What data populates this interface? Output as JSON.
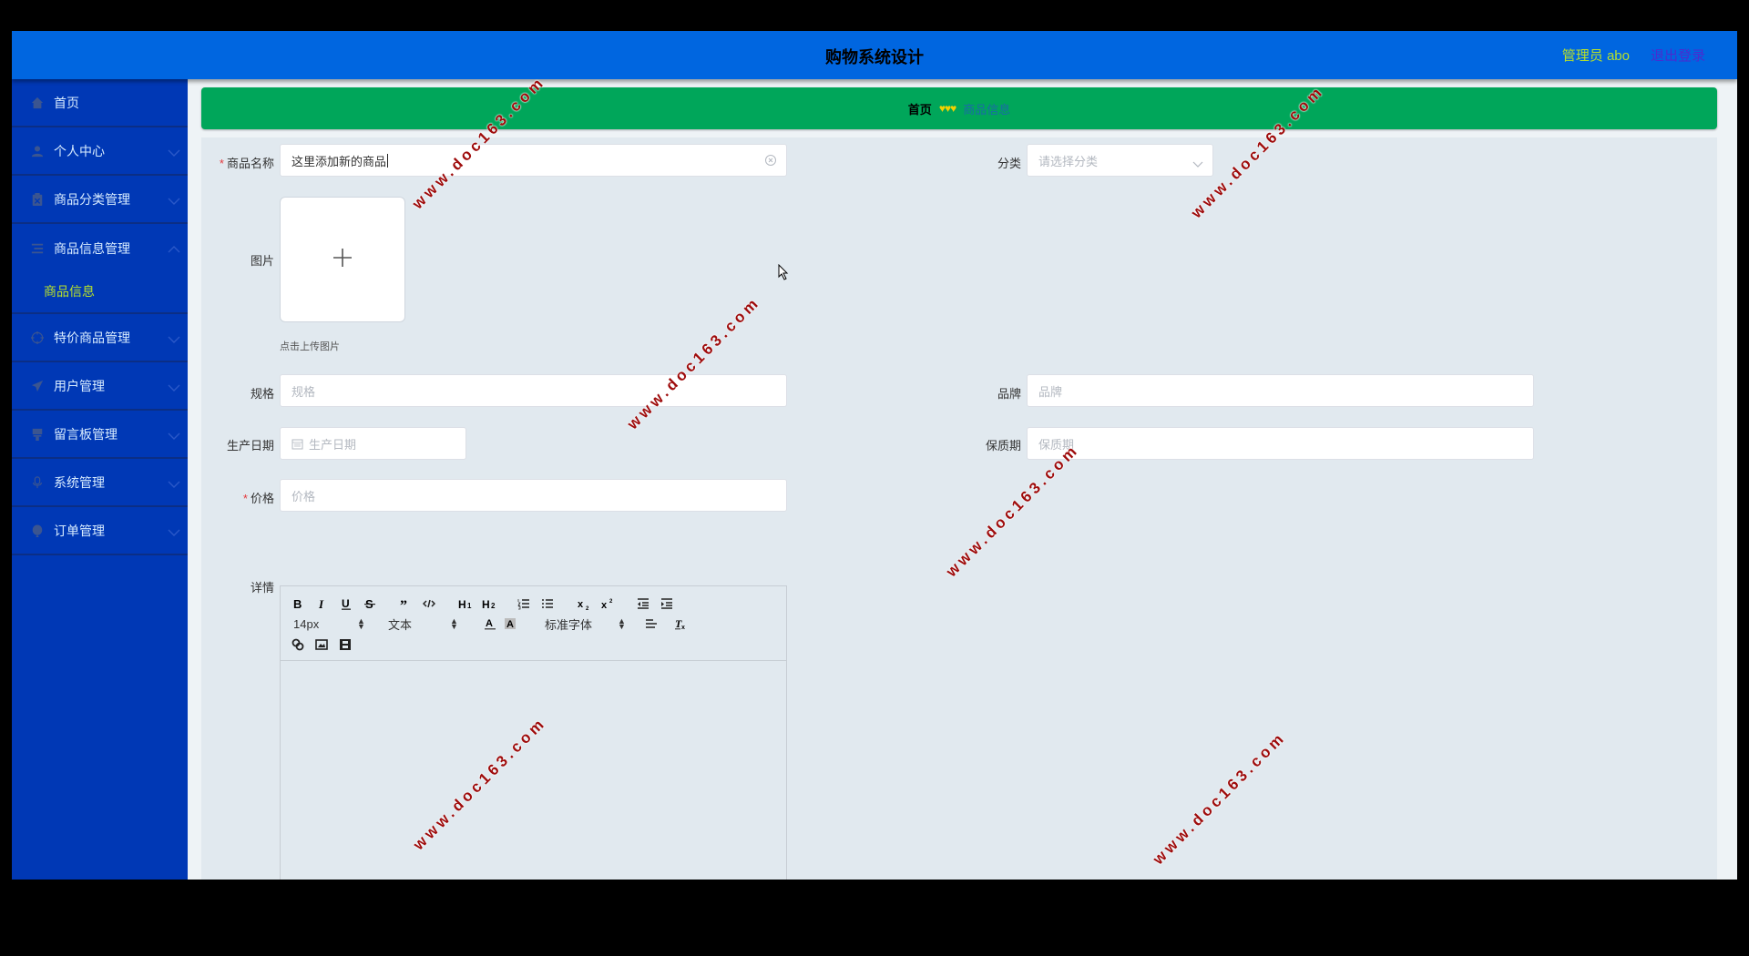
{
  "header": {
    "title": "购物系统设计",
    "user_label": "管理员 abo",
    "logout_label": "退出登录"
  },
  "sidebar": {
    "items": [
      {
        "label": "首页",
        "icon": "home-icon",
        "has_chevron": false
      },
      {
        "label": "个人中心",
        "icon": "user-icon",
        "has_chevron": true
      },
      {
        "label": "商品分类管理",
        "icon": "clipboard-icon",
        "has_chevron": true
      },
      {
        "label": "商品信息管理",
        "icon": "list-icon",
        "has_chevron": true,
        "open": true,
        "children": [
          {
            "label": "商品信息",
            "active": true
          }
        ]
      },
      {
        "label": "特价商品管理",
        "icon": "crosshair-icon",
        "has_chevron": true
      },
      {
        "label": "用户管理",
        "icon": "send-icon",
        "has_chevron": true
      },
      {
        "label": "留言板管理",
        "icon": "brush-icon",
        "has_chevron": true
      },
      {
        "label": "系统管理",
        "icon": "microphone-icon",
        "has_chevron": true
      },
      {
        "label": "订单管理",
        "icon": "balloon-icon",
        "has_chevron": true
      }
    ]
  },
  "breadcrumb": {
    "home": "首页",
    "separator": "♥♥♥",
    "current": "商品信息"
  },
  "form": {
    "name": {
      "label": "商品名称",
      "required": true,
      "value": "这里添加新的商品"
    },
    "category": {
      "label": "分类",
      "placeholder": "请选择分类"
    },
    "image": {
      "label": "图片",
      "tip": "点击上传图片"
    },
    "spec": {
      "label": "规格",
      "placeholder": "规格"
    },
    "brand": {
      "label": "品牌",
      "placeholder": "品牌"
    },
    "production_date": {
      "label": "生产日期",
      "placeholder": "生产日期"
    },
    "shelf_life": {
      "label": "保质期",
      "placeholder": "保质期"
    },
    "price": {
      "label": "价格",
      "required": true,
      "placeholder": "价格"
    },
    "details": {
      "label": "详情"
    }
  },
  "editor": {
    "font_size": "14px",
    "header_select": "文本",
    "font_family": "标准字体",
    "buttons": [
      "bold",
      "italic",
      "underline",
      "strike",
      "blockquote",
      "code-block",
      "h1",
      "h2",
      "ordered-list",
      "bullet-list",
      "subscript",
      "superscript",
      "outdent",
      "indent",
      "color",
      "background",
      "align",
      "clean",
      "link",
      "image",
      "video"
    ]
  },
  "watermark": "www.doc163.com",
  "colors": {
    "header_bg": "#0066e0",
    "sidebar_bg": "#0038b5",
    "breadcrumb_bg": "#00a65a",
    "active_text": "#b7e02a",
    "logout_text": "#4a2bd0",
    "watermark": "#9e0b0b"
  }
}
